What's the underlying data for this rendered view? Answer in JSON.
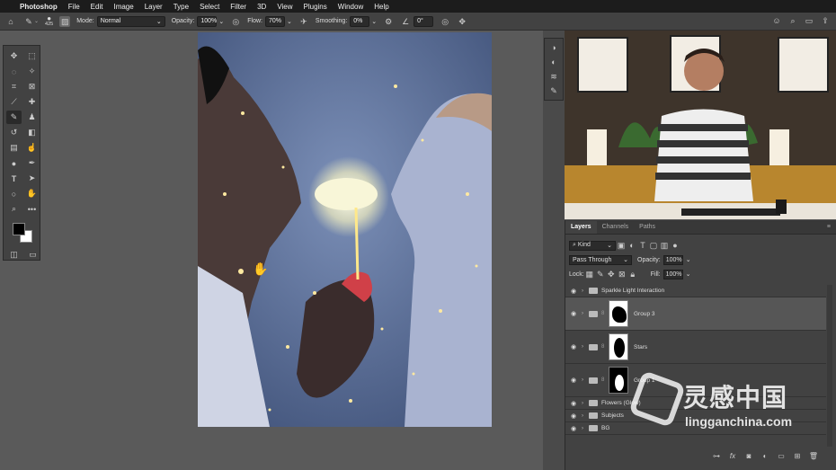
{
  "menu": [
    "Photoshop",
    "File",
    "Edit",
    "Image",
    "Layer",
    "Type",
    "Select",
    "Filter",
    "3D",
    "View",
    "Plugins",
    "Window",
    "Help"
  ],
  "options": {
    "brush_size": "425",
    "mode_label": "Mode:",
    "mode_value": "Normal",
    "opacity_label": "Opacity:",
    "opacity_value": "100%",
    "flow_label": "Flow:",
    "flow_value": "70%",
    "smoothing_label": "Smoothing:",
    "smoothing_value": "0%",
    "angle_value": "0°"
  },
  "layers_panel": {
    "tabs": [
      "Layers",
      "Channels",
      "Paths"
    ],
    "kind_label": "Kind",
    "blend_mode": "Pass Through",
    "opacity_label": "Opacity:",
    "opacity_value": "100%",
    "lock_label": "Lock:",
    "fill_label": "Fill:",
    "fill_value": "100%",
    "layers": [
      {
        "name": "Sparkle Light Interaction",
        "type": "group",
        "selected": false
      },
      {
        "name": "Group 3",
        "type": "group-mask",
        "selected": true
      },
      {
        "name": "Stars",
        "type": "group-mask",
        "selected": false
      },
      {
        "name": "Group 1",
        "type": "group-mask",
        "selected": false
      },
      {
        "name": "Flowers (Glow)",
        "type": "group",
        "selected": false
      },
      {
        "name": "Subjects",
        "type": "group",
        "selected": false
      },
      {
        "name": "BG",
        "type": "group",
        "selected": false
      }
    ]
  },
  "watermark": {
    "text": "灵感中国",
    "url": "lingganchina.com"
  },
  "colors": {
    "menubar": "#1c1c1c",
    "panel": "#424242",
    "canvas_bg": "#5a5a5a"
  }
}
